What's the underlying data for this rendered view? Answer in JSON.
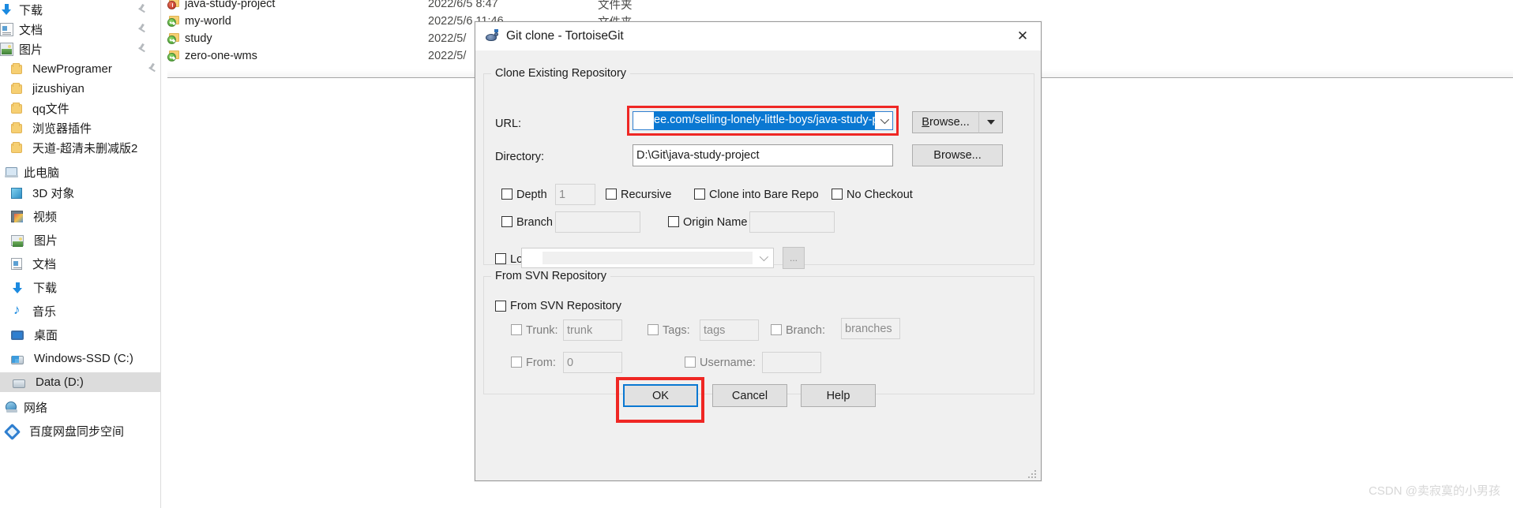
{
  "explorer": {
    "nav_pane": {
      "quick_access_items": [
        {
          "label": "下载",
          "icon": "download-icon",
          "pinned": true
        },
        {
          "label": "文档",
          "icon": "documents-icon",
          "pinned": true
        },
        {
          "label": "图片",
          "icon": "pictures-icon",
          "pinned": true
        },
        {
          "label": "NewProgramer",
          "icon": "folder-icon",
          "pinned": true
        },
        {
          "label": "jizushiyan",
          "icon": "folder-icon",
          "pinned": false
        },
        {
          "label": "qq文件",
          "icon": "folder-icon",
          "pinned": false
        },
        {
          "label": "浏览器插件",
          "icon": "folder-icon",
          "pinned": false
        },
        {
          "label": "天道-超清未删减版2",
          "icon": "folder-icon",
          "pinned": false
        }
      ],
      "this_pc": {
        "label": "此电脑",
        "icon": "this-pc-icon"
      },
      "this_pc_items": [
        {
          "label": "3D 对象",
          "icon": "3d-objects-icon"
        },
        {
          "label": "视频",
          "icon": "videos-icon"
        },
        {
          "label": "图片",
          "icon": "pictures-icon"
        },
        {
          "label": "文档",
          "icon": "documents-icon"
        },
        {
          "label": "下载",
          "icon": "download-icon"
        },
        {
          "label": "音乐",
          "icon": "music-icon"
        },
        {
          "label": "桌面",
          "icon": "desktop-icon"
        },
        {
          "label": "Windows-SSD (C:)",
          "icon": "drive-system-icon"
        },
        {
          "label": "Data (D:)",
          "icon": "drive-icon",
          "selected": true
        }
      ],
      "network": {
        "label": "网络",
        "icon": "network-icon"
      },
      "baidu_sync": {
        "label": "百度网盘同步空间",
        "icon": "baidu-netdisk-icon"
      }
    },
    "file_list": {
      "rows": [
        {
          "name": "java-study-project",
          "overlay": "red",
          "date": "2022/6/5 8:47",
          "type": "文件夹"
        },
        {
          "name": "my-world",
          "overlay": "green",
          "date": "2022/5/6 11:46",
          "type": "文件夹"
        },
        {
          "name": "study",
          "overlay": "green",
          "date": "2022/5/",
          "type": ""
        },
        {
          "name": "zero-one-wms",
          "overlay": "green",
          "date": "2022/5/",
          "type": ""
        }
      ]
    }
  },
  "dialog": {
    "title": "Git clone - TortoiseGit",
    "title_icon": "tortoisegit-icon",
    "close_label": "✕",
    "clone_group": {
      "title": "Clone Existing Repository",
      "url_label": "URL:",
      "url_value": "ee.com/selling-lonely-little-boys/java-study-project.git",
      "url_highlight_color": "#0a78d2",
      "url_annotation_color": "#ef2724",
      "url_browse_label": "Browse...",
      "url_browse_accesskey": "B",
      "url_dropdown_icon": "chevron-down-icon",
      "url_split_icon": "triangle-down-icon",
      "directory_label": "Directory:",
      "directory_value": "D:\\Git\\java-study-project",
      "directory_browse_label": "Browse...",
      "depth_label": "Depth",
      "depth_value": "1",
      "depth_checked": false,
      "recursive_label": "Recursive",
      "recursive_checked": false,
      "bare_repo_label": "Clone into Bare Repo",
      "bare_repo_checked": false,
      "no_checkout_label": "No Checkout",
      "no_checkout_checked": false,
      "branch_label": "Branch",
      "branch_value": "",
      "branch_checked": false,
      "origin_name_label": "Origin Name",
      "origin_name_value": "",
      "origin_name_checked": false,
      "putty_key_label": "Load Putty Key",
      "putty_key_checked": false,
      "putty_key_value": "",
      "putty_browse_label": "...",
      "putty_dropdown_icon": "chevron-down-icon"
    },
    "svn_group": {
      "title": "From SVN Repository",
      "checkbox_label": "From SVN Repository",
      "checkbox_checked": false,
      "trunk_label": "Trunk:",
      "trunk_value": "trunk",
      "trunk_checked": false,
      "tags_label": "Tags:",
      "tags_value": "tags",
      "tags_checked": false,
      "branch_label": "Branch:",
      "branch_value": "branches",
      "branch_checked": false,
      "from_label": "From:",
      "from_value": "0",
      "from_checked": false,
      "username_label": "Username:",
      "username_value": "",
      "username_checked": false
    },
    "footer": {
      "ok_label": "OK",
      "ok_focus_color": "#0a78d2",
      "ok_annotation_color": "#ef2724",
      "cancel_label": "Cancel",
      "help_label": "Help"
    },
    "resize_grip_icon": "resize-grip-icon"
  },
  "watermark": "CSDN @卖寂寞的小男孩"
}
